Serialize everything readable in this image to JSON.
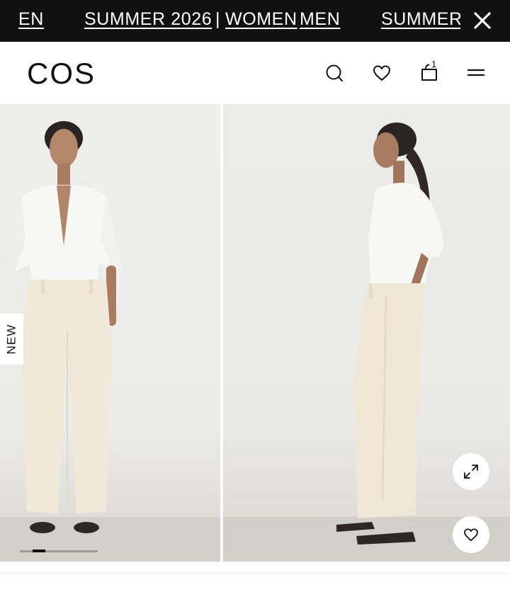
{
  "banner": {
    "items": [
      {
        "label": "EN"
      },
      {
        "label": "SUMMER 2026"
      },
      {
        "label": "|"
      },
      {
        "label": "WOMEN"
      },
      {
        "label": "MEN"
      },
      {
        "label": "SUMMER"
      }
    ],
    "close_icon": "close-icon",
    "background": "#111111"
  },
  "header": {
    "logo": "COS",
    "icons": [
      "search-icon",
      "heart-icon",
      "bag-icon",
      "menu-icon"
    ],
    "bag_count": "1"
  },
  "gallery": {
    "badge": "NEW",
    "images": [
      {
        "name": "product-image-front"
      },
      {
        "name": "product-image-side"
      }
    ],
    "progress": {
      "current": 2,
      "total": 6
    },
    "zoom_icon": "expand-icon",
    "wishlist_icon": "heart-icon"
  }
}
